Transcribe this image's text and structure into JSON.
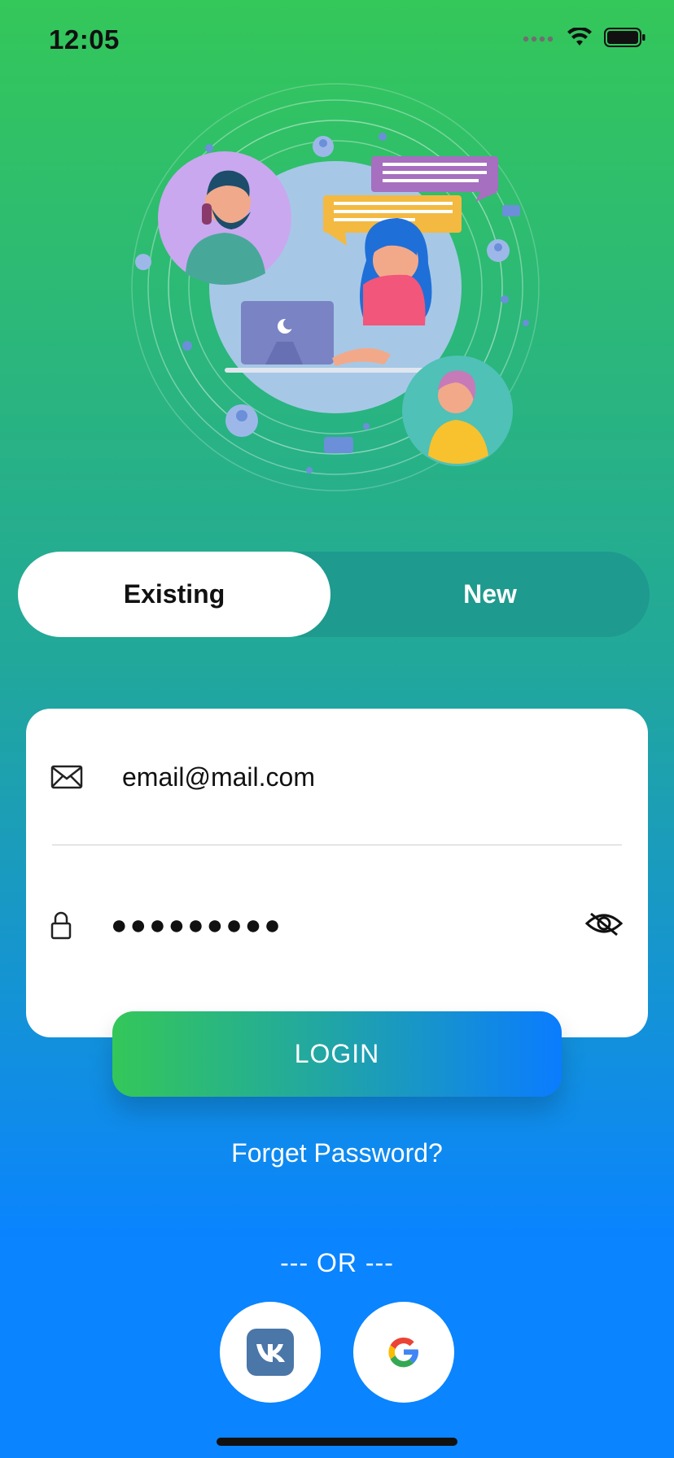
{
  "status_bar": {
    "time": "12:05"
  },
  "segmented": {
    "existing_label": "Existing",
    "new_label": "New",
    "selected": "Existing"
  },
  "form": {
    "email_value": "email@mail.com",
    "password_value": "●●●●●●●●●"
  },
  "buttons": {
    "login_label": "LOGIN"
  },
  "links": {
    "forgot_password": "Forget Password?"
  },
  "divider_text": "--- OR ---",
  "social": [
    {
      "name": "vk-icon"
    },
    {
      "name": "google-icon"
    }
  ],
  "colors": {
    "gradient_top": "#34C759",
    "gradient_bottom": "#0A84FF",
    "segment_track": "#1E9A8E"
  }
}
